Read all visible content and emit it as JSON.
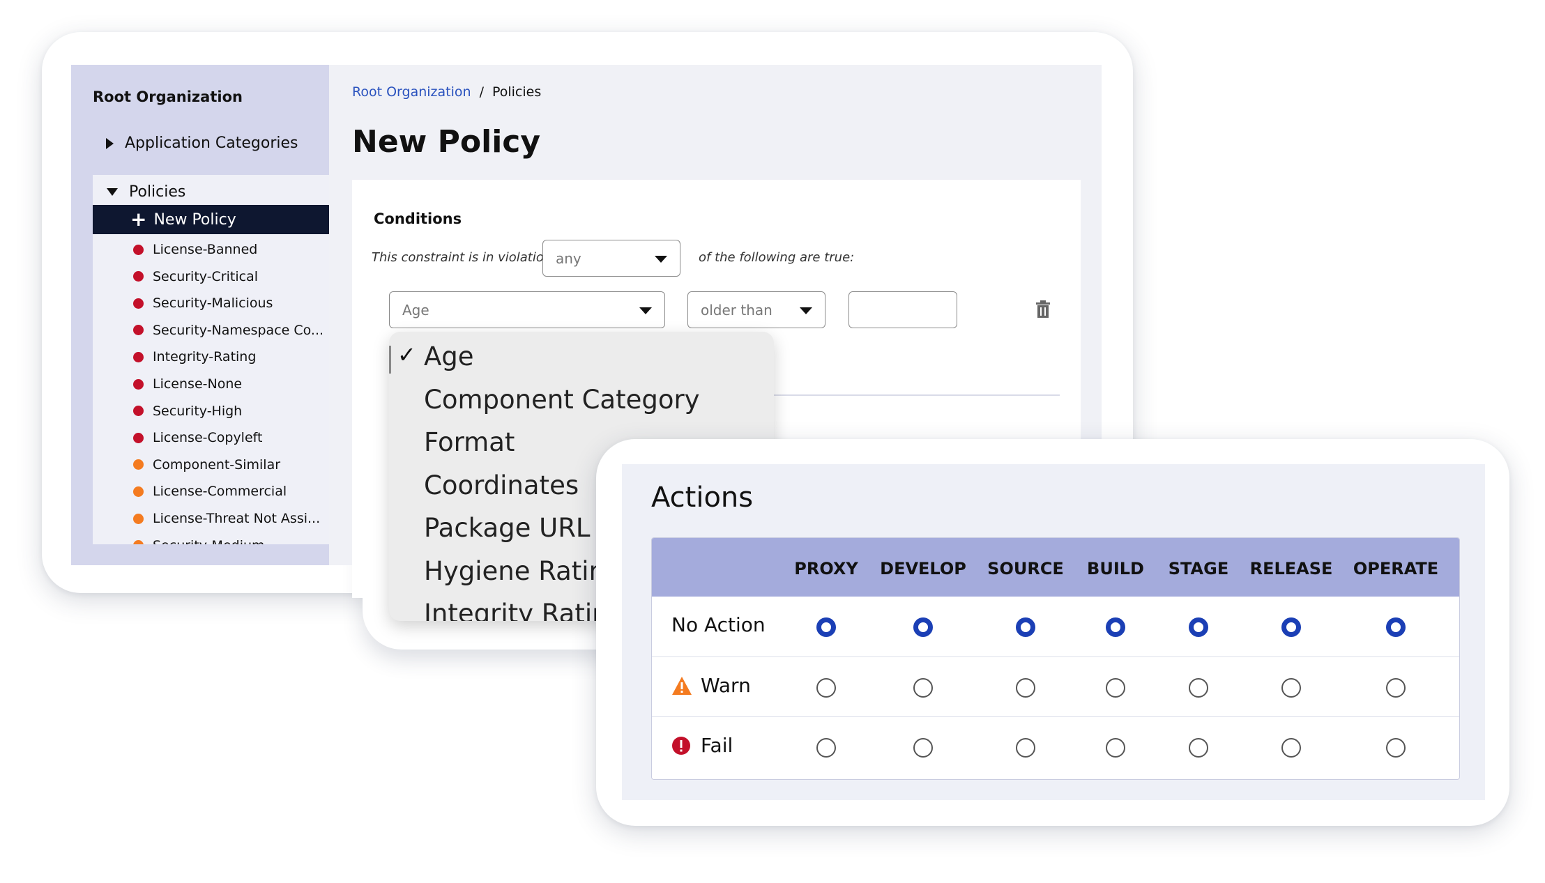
{
  "sidebar": {
    "root_title": "Root Organization",
    "app_categories": "Application Categories",
    "policies_label": "Policies",
    "new_policy": "New Policy",
    "items": [
      {
        "label": "License-Banned",
        "color": "#c3102a"
      },
      {
        "label": "Security-Critical",
        "color": "#c3102a"
      },
      {
        "label": "Security-Malicious",
        "color": "#c3102a"
      },
      {
        "label": "Security-Namespace Co...",
        "color": "#c3102a"
      },
      {
        "label": "Integrity-Rating",
        "color": "#c3102a"
      },
      {
        "label": "License-None",
        "color": "#c3102a"
      },
      {
        "label": "Security-High",
        "color": "#c3102a"
      },
      {
        "label": "License-Copyleft",
        "color": "#c3102a"
      },
      {
        "label": "Component-Similar",
        "color": "#f47b20"
      },
      {
        "label": "License-Commercial",
        "color": "#f47b20"
      },
      {
        "label": "License-Threat Not Assi...",
        "color": "#f47b20"
      },
      {
        "label": "Security-Medium",
        "color": "#f47b20"
      }
    ]
  },
  "breadcrumb": {
    "root": "Root Organization",
    "separator": "/",
    "current": "Policies"
  },
  "page_title": "New Policy",
  "conditions": {
    "title": "Conditions",
    "violation_prefix": "This constraint is in violation if",
    "match_select": "any",
    "violation_suffix": "of the following are true:",
    "field_select": "Age",
    "operator_select": "older than",
    "value": ""
  },
  "dropdown": {
    "selected": "Age",
    "options": [
      "Age",
      "Component Category",
      "Format",
      "Coordinates",
      "Package URL",
      "Hygiene Rating",
      "Integrity Rating"
    ]
  },
  "actions": {
    "title": "Actions",
    "columns": [
      "PROXY",
      "DEVELOP",
      "SOURCE",
      "BUILD",
      "STAGE",
      "RELEASE",
      "OPERATE"
    ],
    "rows": [
      {
        "label": "No Action",
        "icon": "",
        "selected": [
          true,
          true,
          true,
          true,
          true,
          true,
          true
        ]
      },
      {
        "label": "Warn",
        "icon": "warning-icon",
        "selected": [
          false,
          false,
          false,
          false,
          false,
          false,
          false
        ]
      },
      {
        "label": "Fail",
        "icon": "error-icon",
        "selected": [
          false,
          false,
          false,
          false,
          false,
          false,
          false
        ]
      }
    ]
  },
  "colors": {
    "accent": "#1b3fb5",
    "nav_dark": "#0e1730",
    "sidebar_bg": "#d4d6ec",
    "table_header": "#a4abdc",
    "danger": "#c3102a",
    "warning": "#f47b20",
    "link": "#2a52be"
  }
}
